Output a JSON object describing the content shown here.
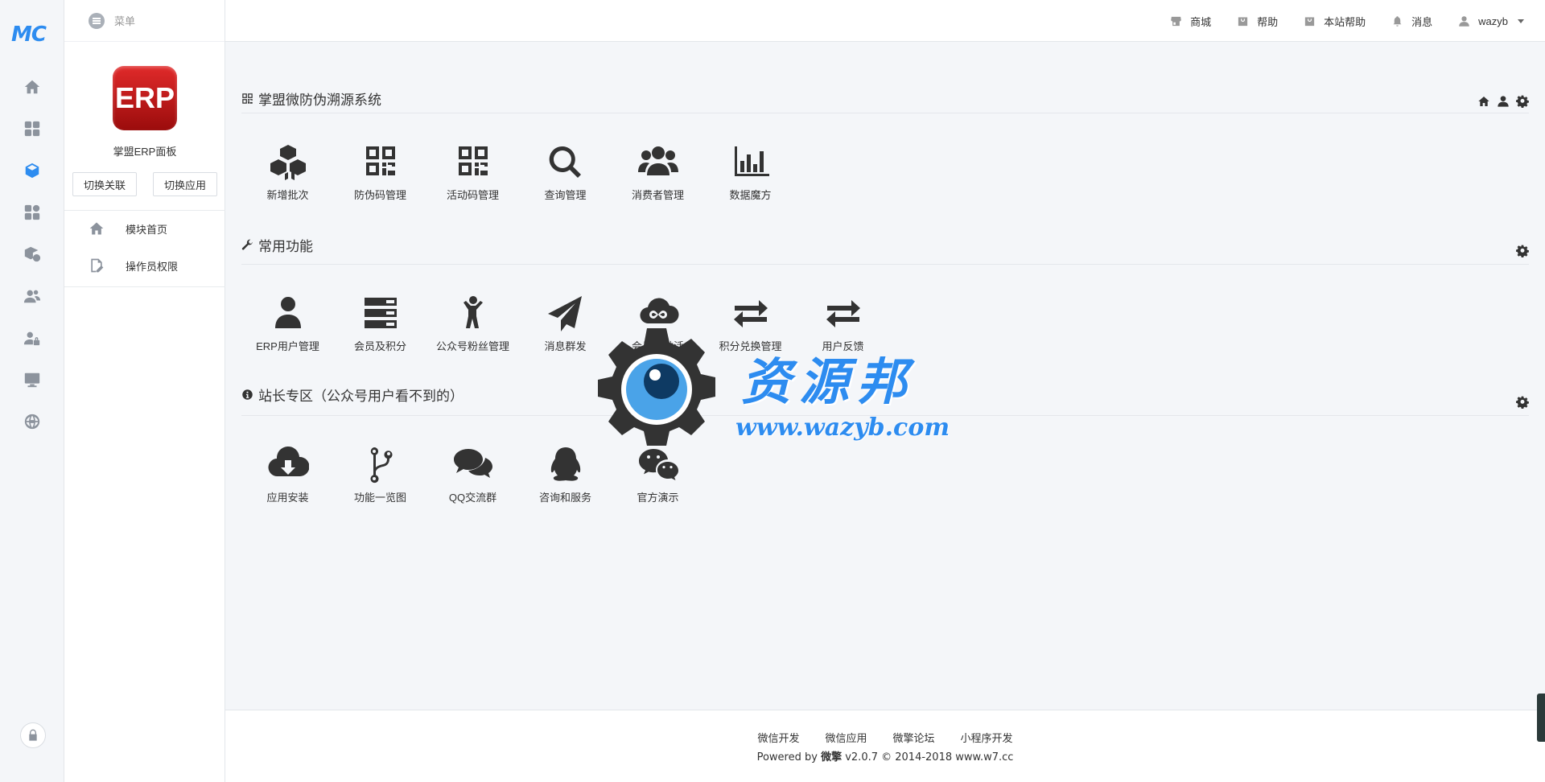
{
  "rail": {
    "logo": "MC"
  },
  "sidebar": {
    "menu_label": "菜单",
    "app_logo_text": "ERP",
    "app_name": "掌盟ERP面板",
    "switch_link": "切换关联",
    "switch_app": "切换应用",
    "items": [
      {
        "label": "模块首页",
        "icon": "home-icon"
      },
      {
        "label": "操作员权限",
        "icon": "edit-doc-icon"
      }
    ]
  },
  "topbar": {
    "items": [
      {
        "label": "商城",
        "icon": "store-icon"
      },
      {
        "label": "帮助",
        "icon": "bag-icon"
      },
      {
        "label": "本站帮助",
        "icon": "bag-icon"
      },
      {
        "label": "消息",
        "icon": "bell-icon"
      },
      {
        "label": "wazyb",
        "icon": "user-icon"
      }
    ]
  },
  "sections": [
    {
      "title": "掌盟微防伪溯源系统",
      "tiles": [
        "新增批次",
        "防伪码管理",
        "活动码管理",
        "查询管理",
        "消费者管理",
        "数据魔方"
      ]
    },
    {
      "title": "常用功能",
      "tiles": [
        "ERP用户管理",
        "会员及积分",
        "公众号粉丝管理",
        "消息群发",
        "会员卡激活",
        "积分兑换管理",
        "用户反馈"
      ]
    },
    {
      "title": "站长专区（公众号用户看不到的）",
      "tiles": [
        "应用安装",
        "功能一览图",
        "QQ交流群",
        "咨询和服务",
        "官方演示"
      ]
    }
  ],
  "footer": {
    "links": [
      "微信开发",
      "微信应用",
      "微擎论坛",
      "小程序开发"
    ],
    "powered_prefix": "Powered by",
    "powered_brand": "微擎",
    "powered_suffix": "v2.0.7 © 2014-2018 www.w7.cc"
  },
  "watermark": {
    "title": "资源邦",
    "url": "www.wazyb.com"
  },
  "colors": {
    "accent": "#2d8cf0",
    "erp_red": "#c41414"
  }
}
